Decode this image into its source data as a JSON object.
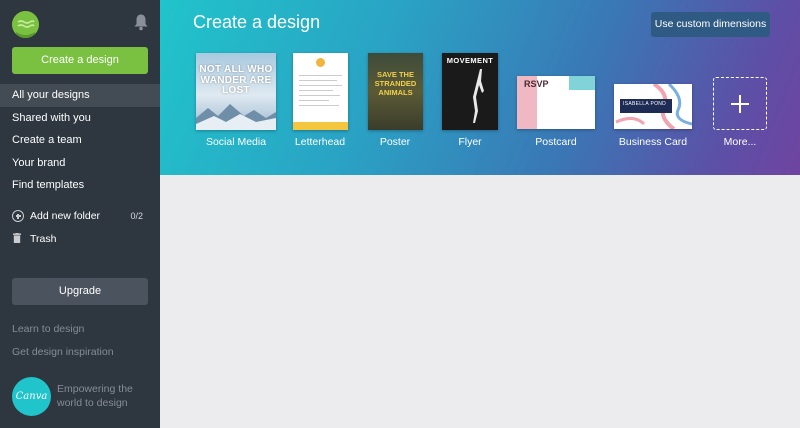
{
  "sidebar": {
    "create_button": "Create a design",
    "nav": [
      "All your designs",
      "Shared with you",
      "Create a team",
      "Your brand",
      "Find templates"
    ],
    "add_folder": "Add new folder",
    "folder_count": "0/2",
    "trash": "Trash",
    "upgrade": "Upgrade",
    "learn": "Learn to design",
    "inspiration": "Get design inspiration",
    "brand": "Canva",
    "tagline": "Empowering the world to design"
  },
  "hero": {
    "title": "Create a design",
    "custom_button": "Use custom dimensions",
    "templates": [
      {
        "label": "Social Media",
        "preview_text": "NOT ALL WHO WANDER ARE LOST"
      },
      {
        "label": "Letterhead"
      },
      {
        "label": "Poster",
        "preview_text": "SAVE THE STRANDED ANIMALS"
      },
      {
        "label": "Flyer",
        "preview_text": "MOVEMENT"
      },
      {
        "label": "Postcard",
        "preview_text": "RSVP"
      },
      {
        "label": "Business Card",
        "preview_text": "ISABELLA POND"
      },
      {
        "label": "More..."
      }
    ]
  },
  "colors": {
    "accent_green": "#7ac142",
    "sidebar_bg": "#2e3640",
    "hero_start": "#20c4cb",
    "hero_end": "#6f44a0"
  },
  "icons": {
    "bell": "bell-icon",
    "add_folder": "plus-circle-icon",
    "trash": "trash-icon",
    "more": "plus-icon"
  }
}
